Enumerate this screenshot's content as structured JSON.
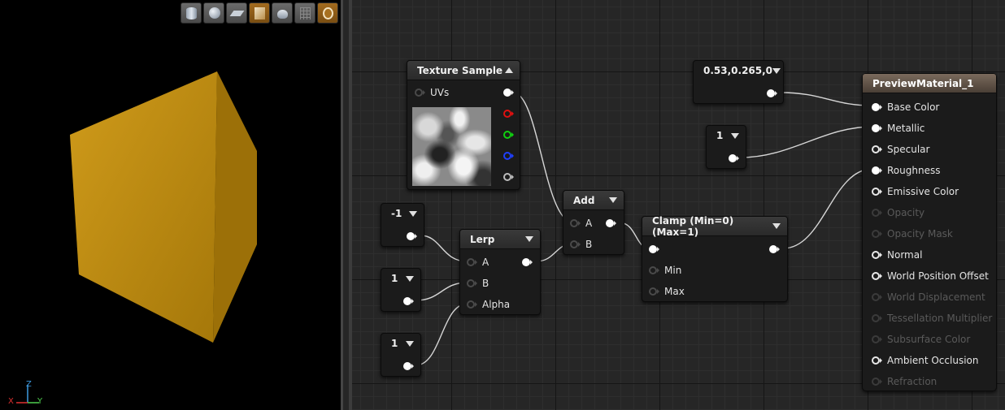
{
  "viewport": {
    "toolbar": [
      {
        "icon": "cylinder-icon",
        "active": false
      },
      {
        "icon": "sphere-icon",
        "active": false
      },
      {
        "icon": "plane-icon",
        "active": false
      },
      {
        "icon": "cube-icon",
        "active": true
      },
      {
        "icon": "teapot-icon",
        "active": false
      },
      {
        "icon": "grid-icon",
        "active": false
      },
      {
        "icon": "realtime-icon",
        "active": true
      }
    ],
    "axes": {
      "z": "Z",
      "y": "Y",
      "x": "X"
    },
    "cube_color": "#c78f12"
  },
  "nodes": {
    "texture_sample": {
      "title": "Texture Sample",
      "uvs": "UVs"
    },
    "constant3": {
      "value": "0.53,0.265,0"
    },
    "const_metallic": {
      "value": "1"
    },
    "const_neg": {
      "value": "-1"
    },
    "const_b": {
      "value": "1"
    },
    "const_alpha": {
      "value": "1"
    },
    "lerp": {
      "title": "Lerp",
      "a": "A",
      "b": "B",
      "alpha": "Alpha"
    },
    "add": {
      "title": "Add",
      "a": "A",
      "b": "B"
    },
    "clamp": {
      "title": "Clamp (Min=0) (Max=1)",
      "min": "Min",
      "max": "Max"
    },
    "result": {
      "title": "PreviewMaterial_1",
      "pins": [
        {
          "label": "Base Color",
          "active": true,
          "connected": true
        },
        {
          "label": "Metallic",
          "active": true,
          "connected": true
        },
        {
          "label": "Specular",
          "active": true,
          "connected": false
        },
        {
          "label": "Roughness",
          "active": true,
          "connected": true
        },
        {
          "label": "Emissive Color",
          "active": true,
          "connected": false
        },
        {
          "label": "Opacity",
          "active": false,
          "connected": false
        },
        {
          "label": "Opacity Mask",
          "active": false,
          "connected": false
        },
        {
          "label": "Normal",
          "active": true,
          "connected": false
        },
        {
          "label": "World Position Offset",
          "active": true,
          "connected": false
        },
        {
          "label": "World Displacement",
          "active": false,
          "connected": false
        },
        {
          "label": "Tessellation Multiplier",
          "active": false,
          "connected": false
        },
        {
          "label": "Subsurface Color",
          "active": false,
          "connected": false
        },
        {
          "label": "Ambient Occlusion",
          "active": true,
          "connected": false
        },
        {
          "label": "Refraction",
          "active": false,
          "connected": false
        }
      ]
    }
  },
  "colors": {
    "grid_bg": "#262626",
    "wire": "#d6d6d6",
    "result_header": "#6b5d50"
  }
}
